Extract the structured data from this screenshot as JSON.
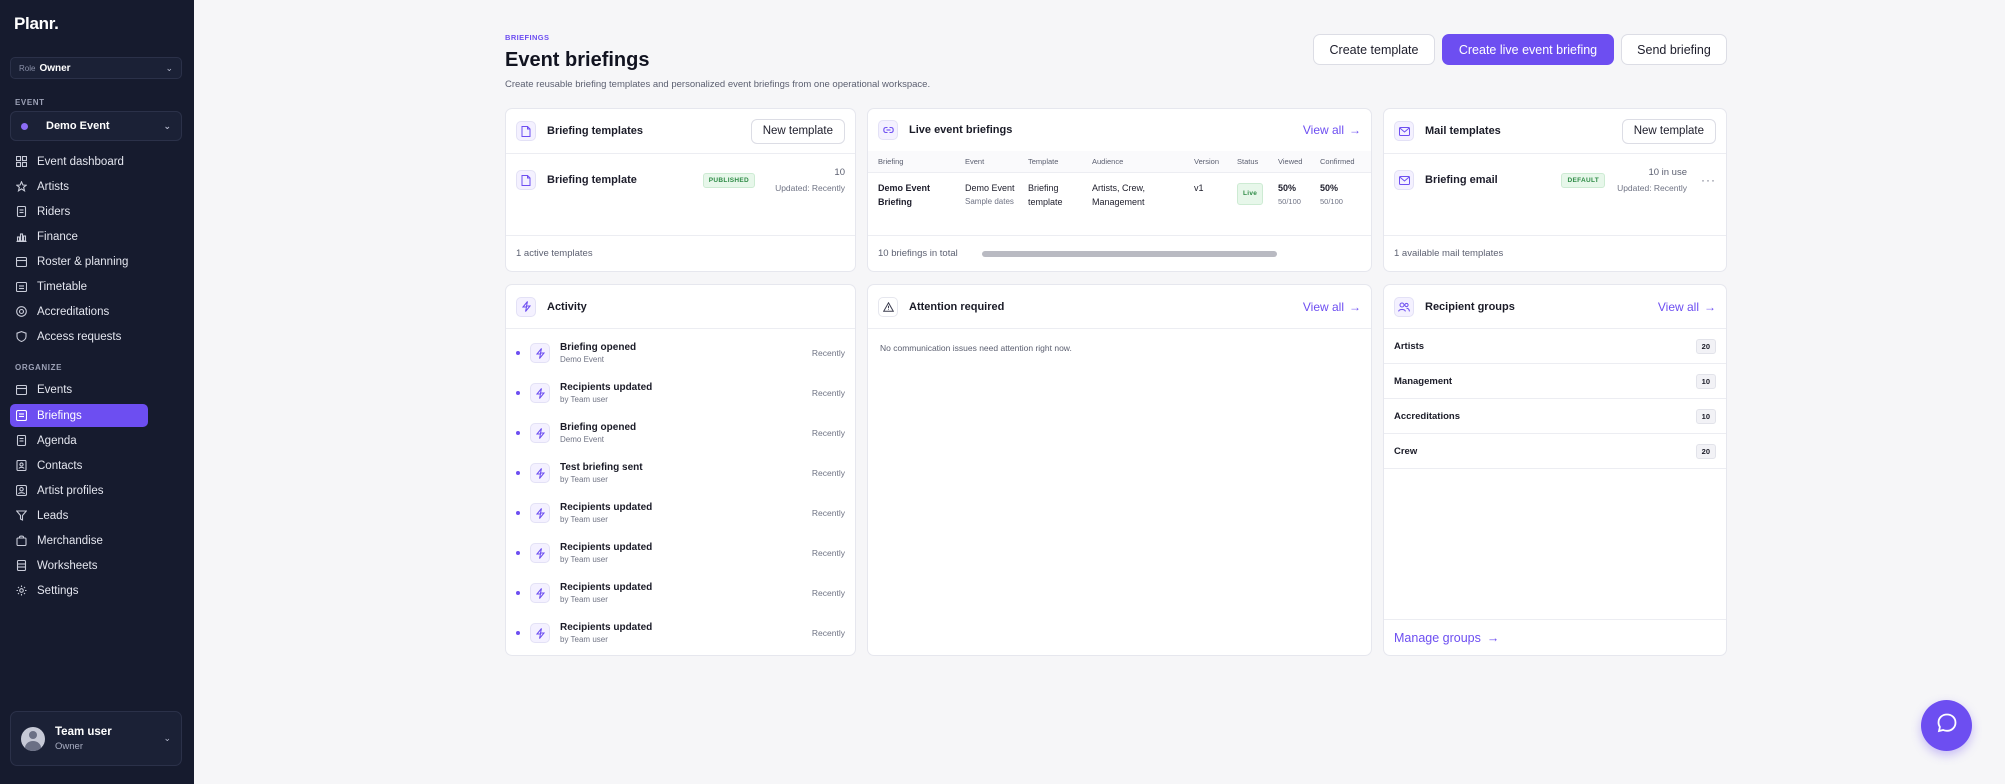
{
  "app": {
    "logo": "Planr."
  },
  "sidebar": {
    "role": {
      "label": "Role",
      "value": "Owner"
    },
    "event_section": "EVENT",
    "event_select": "Demo Event",
    "event_items": [
      {
        "label": "Event dashboard",
        "icon": "grid-icon"
      },
      {
        "label": "Artists",
        "icon": "star-icon"
      },
      {
        "label": "Riders",
        "icon": "document-icon"
      },
      {
        "label": "Finance",
        "icon": "chart-icon"
      },
      {
        "label": "Roster & planning",
        "icon": "calendar-icon"
      },
      {
        "label": "Timetable",
        "icon": "clock-icon"
      },
      {
        "label": "Accreditations",
        "icon": "badge-icon"
      },
      {
        "label": "Access requests",
        "icon": "shield-icon"
      }
    ],
    "organize_section": "ORGANIZE",
    "organize_items": [
      {
        "label": "Events",
        "icon": "calendar-icon"
      },
      {
        "label": "Briefings",
        "icon": "briefing-icon",
        "active": true
      },
      {
        "label": "Agenda",
        "icon": "agenda-icon"
      },
      {
        "label": "Contacts",
        "icon": "contacts-icon"
      },
      {
        "label": "Artist profiles",
        "icon": "profile-icon"
      },
      {
        "label": "Leads",
        "icon": "funnel-icon"
      },
      {
        "label": "Merchandise",
        "icon": "bag-icon"
      },
      {
        "label": "Worksheets",
        "icon": "sheet-icon"
      },
      {
        "label": "Settings",
        "icon": "gear-icon"
      }
    ],
    "user": {
      "name": "Team user",
      "role": "Owner"
    }
  },
  "header": {
    "eyebrow": "BRIEFINGS",
    "title": "Event briefings",
    "subtitle": "Create reusable briefing templates and personalized event briefings from one operational workspace.",
    "buttons": {
      "create_template": "Create template",
      "create_live": "Create live event briefing",
      "send": "Send briefing"
    }
  },
  "briefing_templates": {
    "title": "Briefing templates",
    "new_button": "New template",
    "item": {
      "name": "Briefing template",
      "status": "PUBLISHED",
      "count": "10",
      "updated": "Updated: Recently"
    },
    "footer": "1 active templates"
  },
  "live_briefings": {
    "title": "Live event briefings",
    "view_all": "View all",
    "columns": [
      "Briefing",
      "Event",
      "Template",
      "Audience",
      "Version",
      "Status",
      "Viewed",
      "Confirmed"
    ],
    "row": {
      "briefing": "Demo Event Briefing",
      "event": "Demo Event",
      "event_sub": "Sample dates",
      "template": "Briefing template",
      "audience": "Artists, Crew, Management",
      "version": "v1",
      "status": "Live",
      "viewed": "50%",
      "viewed_sub": "50/100",
      "confirmed": "50%",
      "confirmed_sub": "50/100"
    },
    "footer": "10 briefings in total"
  },
  "mail_templates": {
    "title": "Mail templates",
    "new_button": "New template",
    "item": {
      "name": "Briefing email",
      "badge": "DEFAULT",
      "usage": "10 in use",
      "updated": "Updated: Recently"
    },
    "footer": "1 available mail templates"
  },
  "activity": {
    "title": "Activity",
    "items": [
      {
        "title": "Briefing opened",
        "sub": "Demo Event",
        "time": "Recently"
      },
      {
        "title": "Recipients updated",
        "sub": "by Team user",
        "time": "Recently"
      },
      {
        "title": "Briefing opened",
        "sub": "Demo Event",
        "time": "Recently"
      },
      {
        "title": "Test briefing sent",
        "sub": "by Team user",
        "time": "Recently"
      },
      {
        "title": "Recipients updated",
        "sub": "by Team user",
        "time": "Recently"
      },
      {
        "title": "Recipients updated",
        "sub": "by Team user",
        "time": "Recently"
      },
      {
        "title": "Recipients updated",
        "sub": "by Team user",
        "time": "Recently"
      },
      {
        "title": "Recipients updated",
        "sub": "by Team user",
        "time": "Recently"
      }
    ]
  },
  "attention": {
    "title": "Attention required",
    "view_all": "View all",
    "message": "No communication issues need attention right now."
  },
  "recipient_groups": {
    "title": "Recipient groups",
    "view_all": "View all",
    "groups": [
      {
        "name": "Artists",
        "count": "20"
      },
      {
        "name": "Management",
        "count": "10"
      },
      {
        "name": "Accreditations",
        "count": "10"
      },
      {
        "name": "Crew",
        "count": "20"
      }
    ],
    "manage": "Manage groups"
  },
  "colors": {
    "accent": "#6d4ef1",
    "sidebar": "#161b2e",
    "success": "#2e8b46"
  }
}
